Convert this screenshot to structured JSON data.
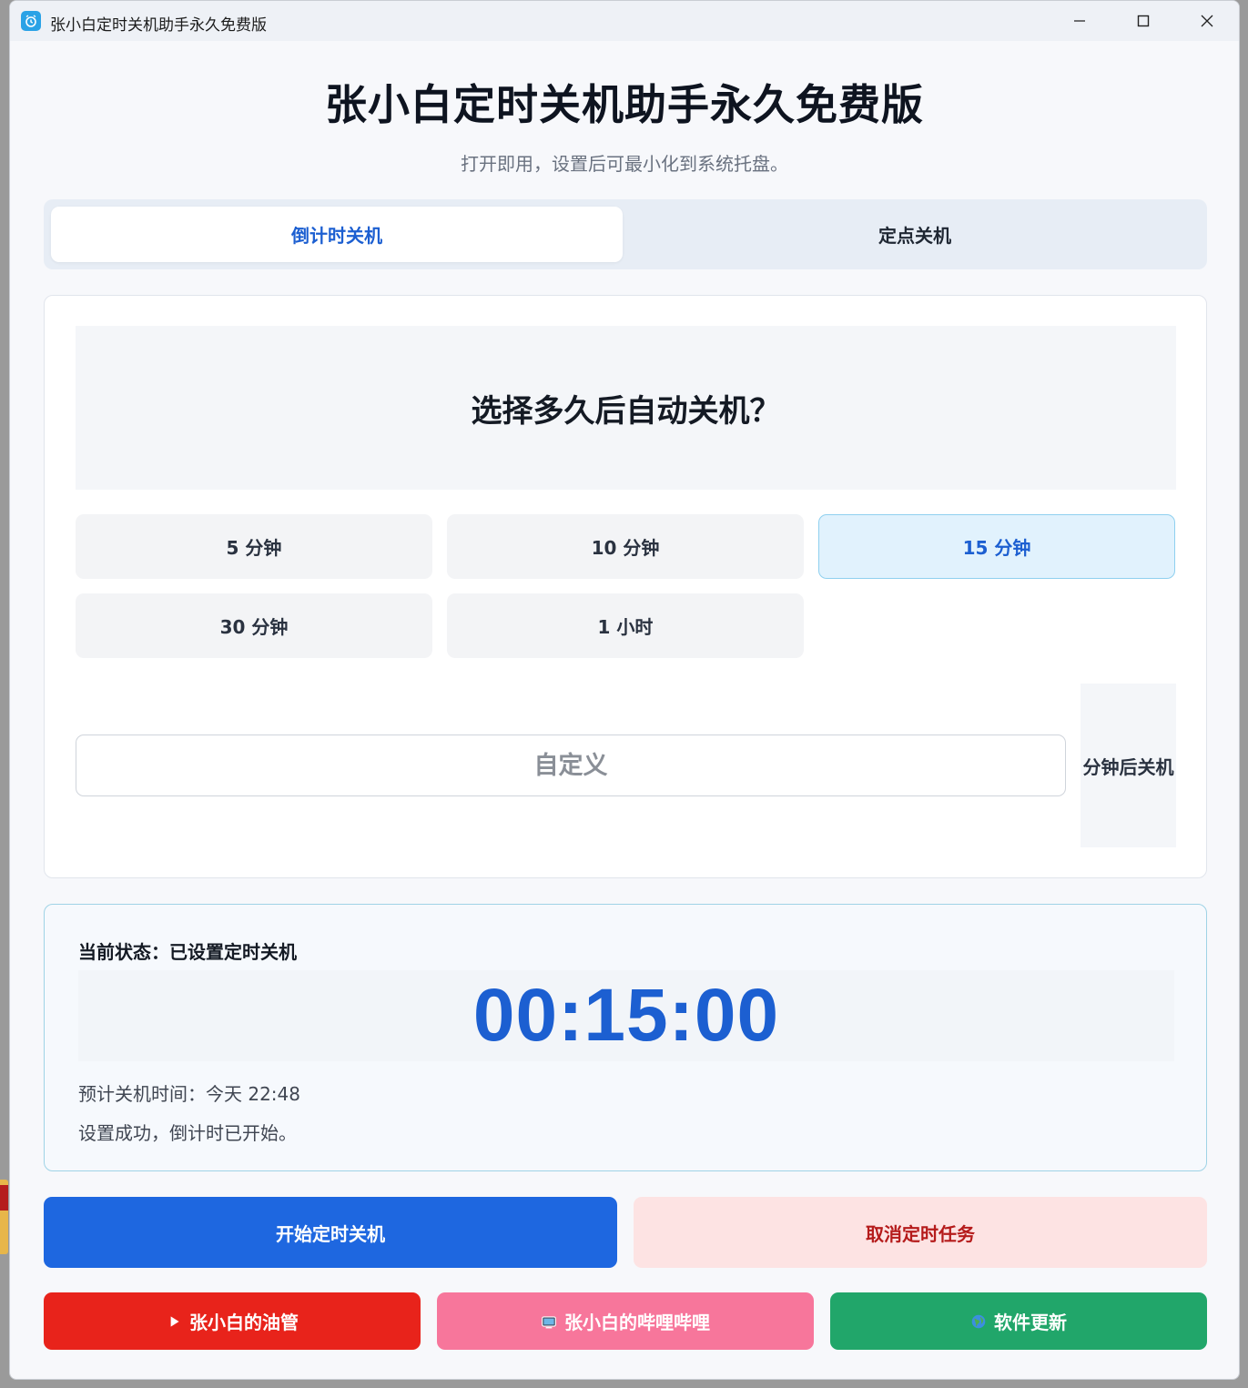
{
  "window": {
    "title": "张小白定时关机助手永久免费版",
    "controls": {
      "minimize": "minimize",
      "maximize": "maximize",
      "close": "close"
    }
  },
  "header": {
    "title": "张小白定时关机助手永久免费版",
    "subtitle": "打开即用，设置后可最小化到系统托盘。"
  },
  "tabs": [
    {
      "label": "倒计时关机",
      "active": true
    },
    {
      "label": "定点关机",
      "active": false
    }
  ],
  "countdown": {
    "question": "选择多久后自动关机？",
    "options": [
      {
        "label": "5 分钟",
        "selected": false
      },
      {
        "label": "10 分钟",
        "selected": false
      },
      {
        "label": "15 分钟",
        "selected": true
      },
      {
        "label": "30 分钟",
        "selected": false
      },
      {
        "label": "1 小时",
        "selected": false
      }
    ],
    "custom": {
      "placeholder": "自定义",
      "value": "",
      "unit": "分钟后关机"
    }
  },
  "status": {
    "line": "当前状态：已设置定时关机",
    "timer": "00:15:00",
    "eta": "预计关机时间：今天 22:48",
    "message": "设置成功，倒计时已开始。"
  },
  "actions": {
    "start": "开始定时关机",
    "cancel": "取消定时任务"
  },
  "links": {
    "youtube": "张小白的油管",
    "bilibili": "张小白的哔哩哔哩",
    "update": "软件更新"
  },
  "colors": {
    "accent": "#1e67e0",
    "cancel_bg": "#fde3e3",
    "cancel_text": "#b51b1b",
    "youtube": "#e8231b",
    "bilibili": "#f7769b",
    "update": "#21a66a",
    "selected_bg": "#e1f2fd"
  }
}
